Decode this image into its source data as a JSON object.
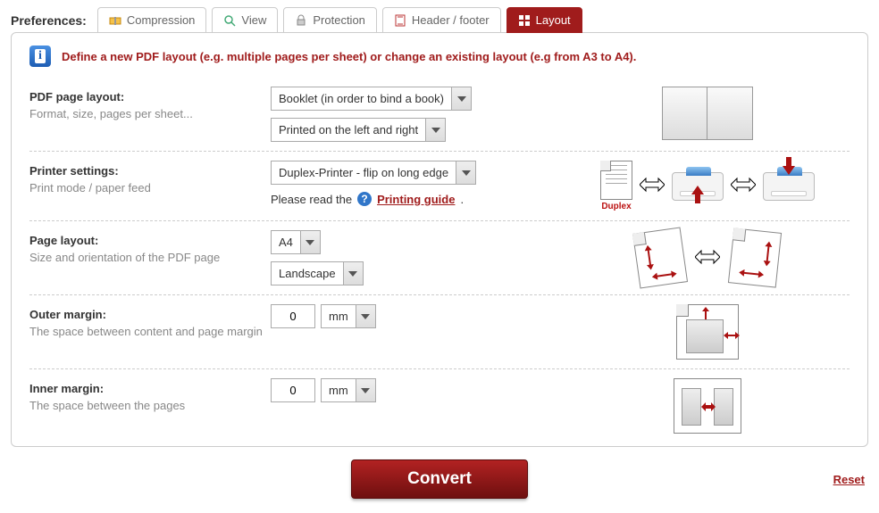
{
  "prefLabel": "Preferences:",
  "tabs": [
    "Compression",
    "View",
    "Protection",
    "Header / footer",
    "Layout"
  ],
  "activeTab": 4,
  "infoText": "Define a new PDF layout (e.g. multiple pages per sheet) or change an existing layout (e.g from A3 to A4).",
  "rows": {
    "pdfLayout": {
      "title": "PDF page layout:",
      "sub": "Format, size, pages per sheet...",
      "select1": "Booklet (in order to bind a book)",
      "select2": "Printed on the left and right"
    },
    "printer": {
      "title": "Printer settings:",
      "sub": "Print mode / paper feed",
      "select": "Duplex-Printer - flip on long edge",
      "readText": "Please read the",
      "guide": "Printing guide",
      "duplexLabel": "Duplex"
    },
    "page": {
      "title": "Page layout:",
      "sub": "Size and orientation of the PDF page",
      "size": "A4",
      "orient": "Landscape"
    },
    "outer": {
      "title": "Outer margin:",
      "sub": "The space between content and page margin",
      "value": "0",
      "unit": "mm"
    },
    "inner": {
      "title": "Inner margin:",
      "sub": "The space between the pages",
      "value": "0",
      "unit": "mm"
    }
  },
  "convert": "Convert",
  "reset": "Reset",
  "period": "."
}
